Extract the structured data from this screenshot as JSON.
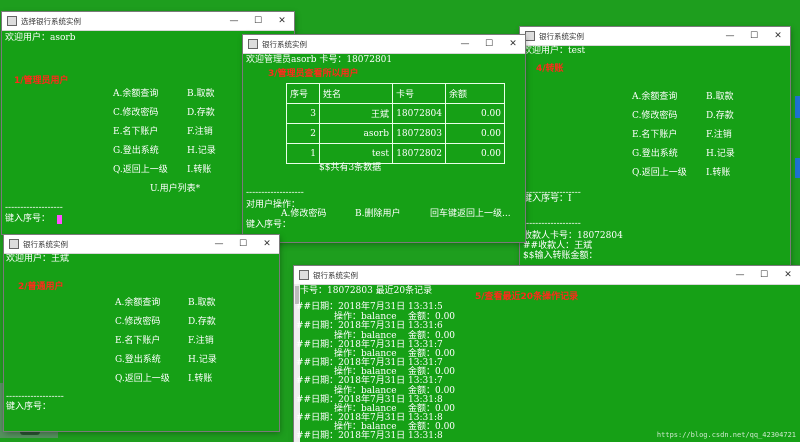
{
  "watermark": "https://blog.csdn.net/qq_42304721",
  "window_controls": {
    "minimize": "—",
    "maximize": "☐",
    "close": "✕"
  },
  "win1": {
    "title": "选择银行系统实例",
    "welcome": "欢迎用户：asorb",
    "annotation": "1/管理员用户",
    "menu": [
      "A.余额查询",
      "B.取款",
      "C.修改密码",
      "D.存款",
      "E.名下账户",
      "F.注销",
      "G.登出系统",
      "H.记录",
      "Q.返回上一级",
      "I.转账"
    ],
    "extra": "U.用户列表*",
    "divider": "-------------------",
    "prompt": "键入序号："
  },
  "win2": {
    "title": "银行系统实例",
    "header": "欢迎管理员asorb 卡号：18072801",
    "annotation": "3/管理员查看所以用户",
    "table": {
      "headers": [
        "序号",
        "姓名",
        "卡号",
        "余额"
      ],
      "rows": [
        [
          "3",
          "王斌",
          "18072804",
          "0.00"
        ],
        [
          "2",
          "asorb",
          "18072803",
          "0.00"
        ],
        [
          "1",
          "test",
          "18072802",
          "0.00"
        ]
      ]
    },
    "summary": "$$共有3条数据",
    "divider": "-------------------",
    "ops_label": "对用户操作：",
    "ops": [
      "A.修改密码",
      "B.删除用户",
      "回车键返回上一级..."
    ],
    "prompt": "键入序号："
  },
  "win3": {
    "title": "银行系统实例",
    "welcome": "欢迎用户：test",
    "annotation": "4/转账",
    "menu": [
      "A.余额查询",
      "B.取款",
      "C.修改密码",
      "D.存款",
      "E.名下账户",
      "F.注销",
      "G.登出系统",
      "H.记录",
      "Q.返回上一级",
      "I.转账"
    ],
    "divider": "-------------------",
    "prompt": "键入序号：I",
    "divider2": "-------------------",
    "recv_card": "收款人卡号：18072804",
    "recv_name": "##收款人：王斌",
    "amount_prompt": "$$输入转账金额："
  },
  "win4": {
    "title": "银行系统实例",
    "welcome": "欢迎用户：王斌",
    "annotation": "2/普通用户",
    "menu": [
      "A.余额查询",
      "B.取款",
      "C.修改密码",
      "D.存款",
      "E.名下账户",
      "F.注销",
      "G.登出系统",
      "H.记录",
      "Q.返回上一级",
      "I.转账"
    ],
    "divider": "-------------------",
    "prompt": "键入序号："
  },
  "win5": {
    "title": "银行系统实例",
    "header": "卡号：18072803 最近20条记录",
    "annotation": "5/查看最近20条操作记录",
    "records": [
      {
        "date": "##日期：2018年7月31日 13:31:5",
        "op": "操作：balance    金额：0.00"
      },
      {
        "date": "##日期：2018年7月31日 13:31:6",
        "op": "操作：balance    金额：0.00"
      },
      {
        "date": "##日期：2018年7月31日 13:31:7",
        "op": "操作：balance    金额：0.00"
      },
      {
        "date": "##日期：2018年7月31日 13:31:7",
        "op": "操作：balance    金额：0.00"
      },
      {
        "date": "##日期：2018年7月31日 13:31:7",
        "op": "操作：balance    金额：0.00"
      },
      {
        "date": "##日期：2018年7月31日 13:31:8",
        "op": "操作：balance    金额：0.00"
      },
      {
        "date": "##日期：2018年7月31日 13:31:8",
        "op": "操作：balance    金额：0.00"
      },
      {
        "date": "##日期：2018年7月31日 13:31:8",
        "op": ""
      }
    ]
  }
}
